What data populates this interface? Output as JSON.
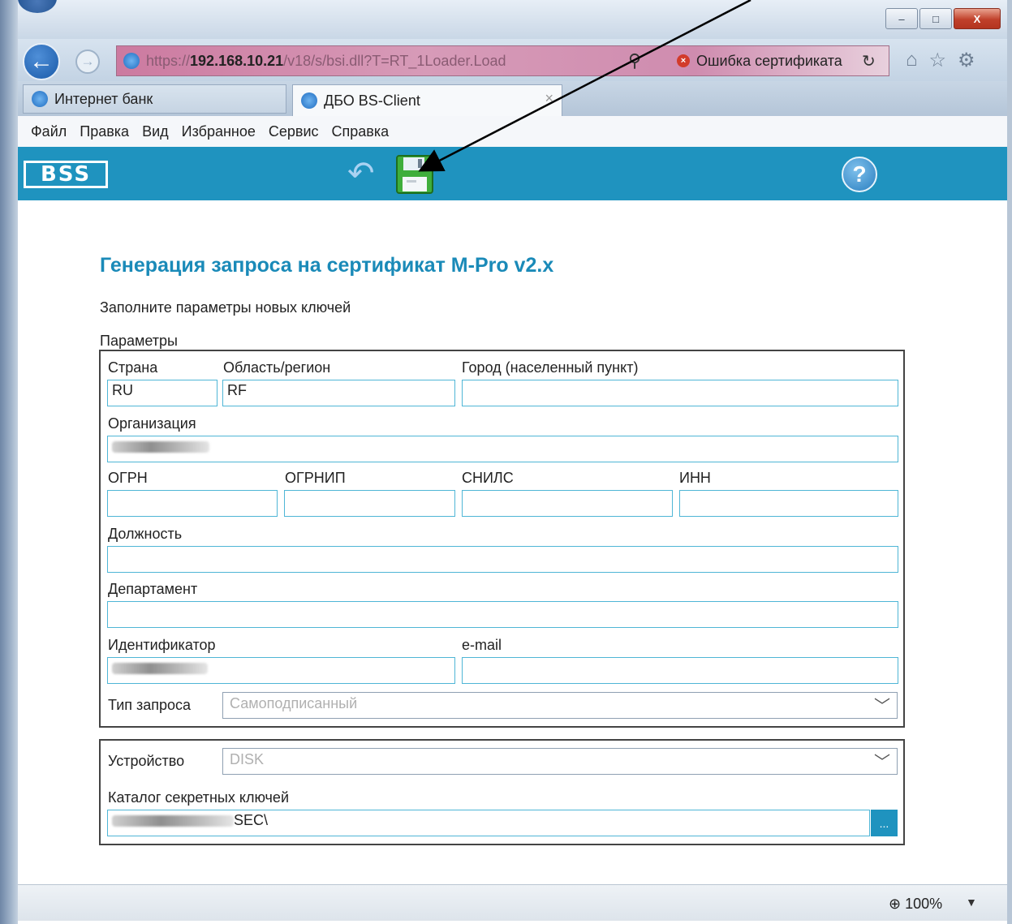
{
  "browser": {
    "url_prefix": "https://",
    "url_host": "192.168.10.21",
    "url_rest": "/v18/s/bsi.dll?T=RT_1Loader.Load",
    "cert_error": "Ошибка сертификата",
    "tabs": [
      {
        "label": "Интернет банк"
      },
      {
        "label": "ДБО BS-Client"
      }
    ],
    "window_buttons": {
      "minimize": "–",
      "maximize": "□",
      "close": "X"
    },
    "menu": [
      "Файл",
      "Правка",
      "Вид",
      "Избранное",
      "Сервис",
      "Справка"
    ],
    "zoom": "100%"
  },
  "app": {
    "logo": "BSS",
    "help": "?"
  },
  "form": {
    "title": "Генерация запроса на сертификат M-Pro v2.x",
    "subtitle": "Заполните параметры новых ключей",
    "params_label": "Параметры",
    "fields": {
      "country_label": "Страна",
      "country_value": "RU",
      "region_label": "Область/регион",
      "region_value": "RF",
      "city_label": "Город (населенный пункт)",
      "city_value": "",
      "org_label": "Организация",
      "ogrn_label": "ОГРН",
      "ogrnip_label": "ОГРНИП",
      "snils_label": "СНИЛС",
      "inn_label": "ИНН",
      "position_label": "Должность",
      "department_label": "Департамент",
      "identifier_label": "Идентификатор",
      "email_label": "e-mail",
      "request_type_label": "Тип запроса",
      "request_type_value": "Самоподписанный"
    },
    "device": {
      "device_label": "Устройство",
      "device_value": "DISK",
      "keys_dir_label": "Каталог секретных ключей",
      "keys_dir_value": "SEC\\",
      "browse_label": "..."
    }
  }
}
